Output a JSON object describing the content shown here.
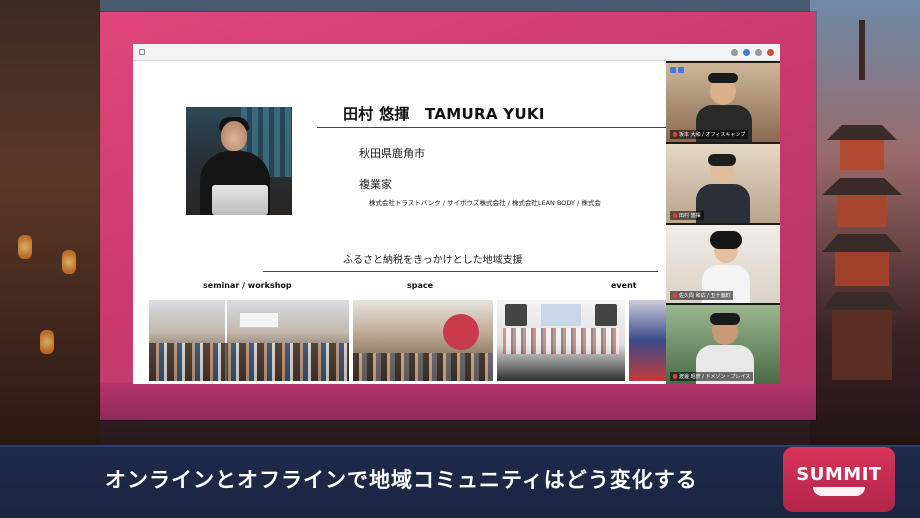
{
  "slide": {
    "name": "田村 悠揮　TAMURA YUKI",
    "location": "秋田県鹿角市",
    "title": "複業家",
    "companies": "株式会社トラストバンク / サイボウズ株式会社 / 株式会社LEAN BODY / 株式会",
    "support_heading": "ふるさと納税をきっかけとした地域支援",
    "categories": {
      "seminar": "seminar / workshop",
      "space": "space",
      "event": "event"
    }
  },
  "participants": [
    {
      "caption": "坂本 大和 / オフィスキャンプ",
      "bg": "#bfa58a"
    },
    {
      "caption": "田村 悠揮",
      "bg": "#d8c9b6"
    },
    {
      "caption": "佐久間 和広 / 五十嵐町",
      "bg": "#e7e2dc"
    },
    {
      "caption": "渡邊 昭彦 / ドメゾン・プレイス",
      "bg": "#7a9a72"
    }
  ],
  "caption_bar": {
    "text": "オンラインとオフラインで地域コミュニティはどう変化する",
    "logo_word": "SUMMIT"
  },
  "colors": {
    "frame_pink": "#d63e74",
    "caption_bg": "#1d2a4a",
    "logo_red": "#d8345a"
  }
}
